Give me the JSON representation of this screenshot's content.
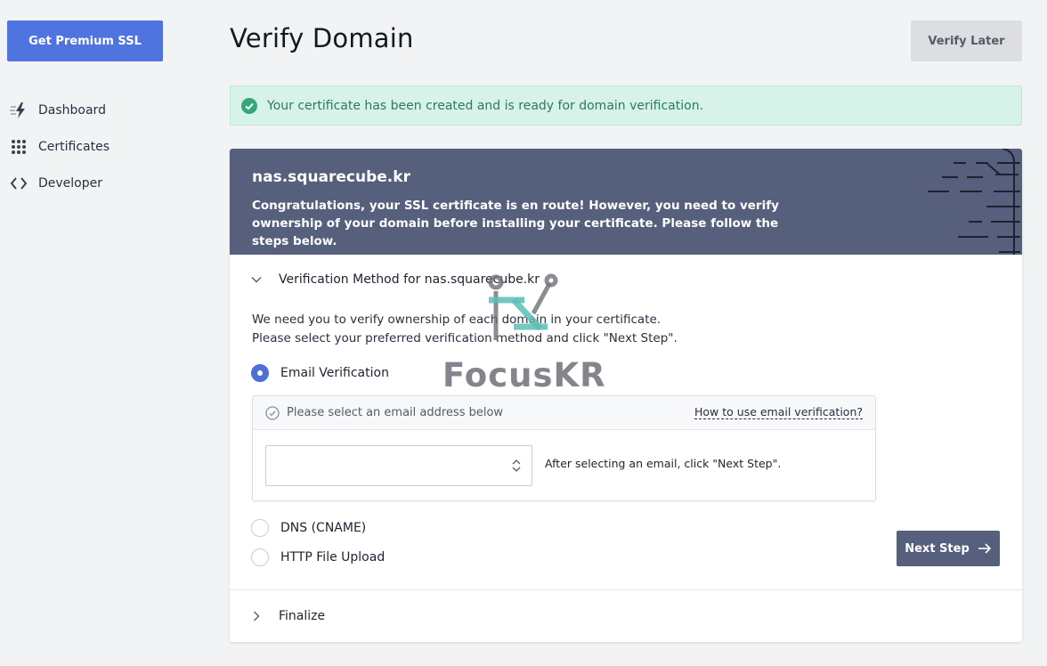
{
  "sidebar": {
    "premium_button": "Get Premium SSL",
    "items": [
      {
        "label": "Dashboard",
        "icon": "lightning-icon"
      },
      {
        "label": "Certificates",
        "icon": "grid-dots-icon"
      },
      {
        "label": "Developer",
        "icon": "code-brackets-icon"
      }
    ]
  },
  "header": {
    "title": "Verify Domain",
    "verify_later": "Verify Later"
  },
  "alert": {
    "message": "Your certificate has been created and is ready for domain verification.",
    "color": "#2f7a5c"
  },
  "card": {
    "domain": "nas.squarecube.kr",
    "banner_message": "Congratulations, your SSL certificate is en route! However, you need to verify ownership of your domain before installing your certificate. Please follow the steps below.",
    "section1_title": "Verification Method for nas.squarecube.kr",
    "instructions_line1": "We need you to verify ownership of each domain in your certificate.",
    "instructions_line2": "Please select your preferred verification method and click \"Next Step\".",
    "methods": [
      {
        "label": "Email Verification",
        "selected": true
      },
      {
        "label": "DNS (CNAME)",
        "selected": false
      },
      {
        "label": "HTTP File Upload",
        "selected": false
      }
    ],
    "email_box": {
      "heading": "Please select an email address below",
      "help_link": "How to use email verification?",
      "select_value": "",
      "note": "After selecting an email, click \"Next Step\"."
    },
    "next_step": "Next Step",
    "section2_title": "Finalize"
  },
  "watermark": {
    "text": "FocusKR"
  },
  "colors": {
    "primary": "#4f74e0",
    "banner": "#565f7c",
    "alert_bg": "#d7f2e8"
  }
}
